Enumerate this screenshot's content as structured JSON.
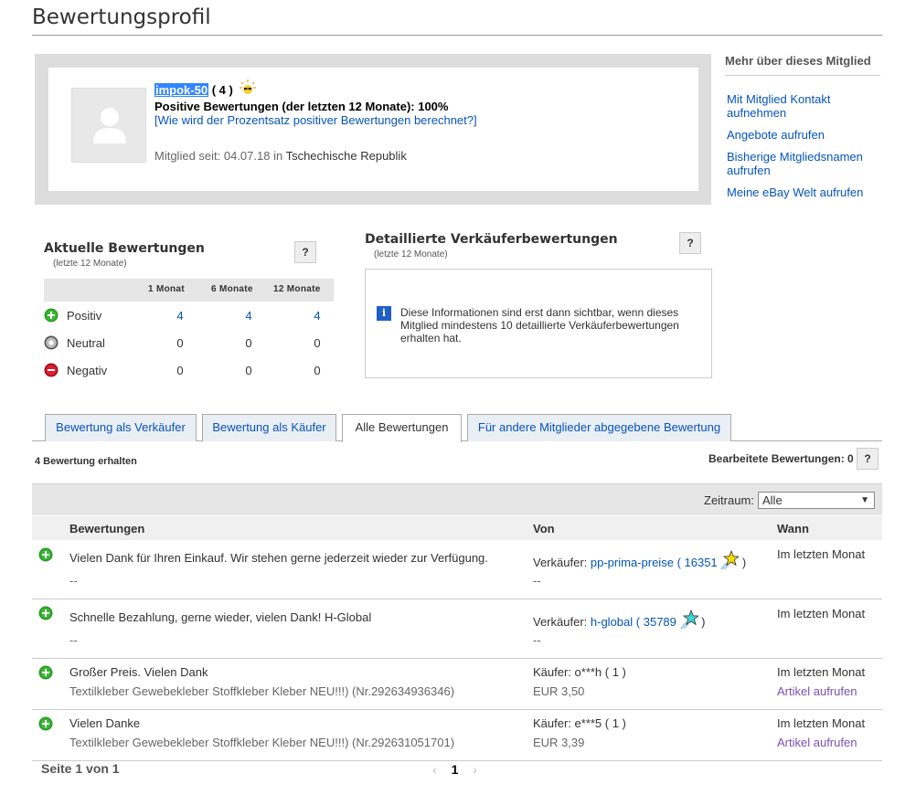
{
  "page_title": "Bewertungsprofil",
  "profile": {
    "username": "impok-50",
    "score": "( 4 )",
    "positive": "Positive Bewertungen (der letzten 12 Monate): 100%",
    "howcalc": "[Wie wird der Prozentsatz positiver Bewertungen berechnet?]",
    "member_label": "Mitglied seit: 04.07.18 in ",
    "member_country": "Tschechische Republik"
  },
  "side": {
    "title": "Mehr über dieses Mitglied",
    "links": [
      "Mit Mitglied Kontakt aufnehmen",
      "Angebote aufrufen",
      "Bisherige Mitgliedsnamen aufrufen",
      "Meine eBay Welt aufrufen"
    ]
  },
  "current": {
    "title": "Aktuelle Bewertungen",
    "sub": "(letzte 12 Monate)",
    "help": "?",
    "cols": [
      "1 Monat",
      "6 Monate",
      "12 Monate"
    ],
    "rows": [
      {
        "label": "Positiv",
        "values": [
          "4",
          "4",
          "4"
        ],
        "icon": "plus-circle-icon",
        "color": "#2a9b26"
      },
      {
        "label": "Neutral",
        "values": [
          "0",
          "0",
          "0"
        ],
        "icon": "neutral-circle-icon",
        "color": "#888888"
      },
      {
        "label": "Negativ",
        "values": [
          "0",
          "0",
          "0"
        ],
        "icon": "minus-circle-icon",
        "color": "#dd1e31"
      }
    ]
  },
  "dsr": {
    "title": "Detaillierte Verkäuferbewertungen",
    "sub": "(letzte 12 Monate)",
    "help": "?",
    "info": "Diese Informationen sind erst dann sichtbar, wenn dieses Mitglied mindestens 10 detaillierte Verkäuferbewertungen erhalten hat."
  },
  "tabs": [
    "Bewertung als Verkäufer",
    "Bewertung als Käufer",
    "Alle Bewertungen",
    "Für andere Mitglieder abgegebene Bewertung"
  ],
  "active_tab": "Alle Bewertungen",
  "received": "4 Bewertung erhalten",
  "processed": "Bearbeitete Bewertungen: 0",
  "filter": {
    "label": "Zeitraum:",
    "selected": "Alle"
  },
  "table": {
    "headers": [
      "Bewertungen",
      "Von",
      "Wann"
    ],
    "rows": [
      {
        "text": "Vielen Dank für Ihren Einkauf. Wir stehen gerne jederzeit wieder zur Verfügung.",
        "sub": "--",
        "from_prefix": "Verkäufer:",
        "from_user": "pp-prima-preise",
        "from_score": "16351",
        "star": "yellow-shooting-star-icon",
        "from_sub": "--",
        "when": "Im letzten Monat",
        "when_sub": ""
      },
      {
        "text": "Schnelle Bezahlung, gerne wieder, vielen Dank! H-Global",
        "sub": "--",
        "from_prefix": "Verkäufer:",
        "from_user": "h-global",
        "from_score": "35789",
        "star": "turquoise-shooting-star-icon",
        "from_sub": "--",
        "when": "Im letzten Monat",
        "when_sub": ""
      },
      {
        "text": "Großer Preis. Vielen Dank",
        "sub": "Textilkleber Gewebekleber Stoffkleber Kleber NEU!!!) (Nr.292634936346)",
        "from_text": "Käufer: o***h ( 1 )",
        "from_sub": "EUR 3,50",
        "when": "Im letzten Monat",
        "when_sub": "Artikel aufrufen"
      },
      {
        "text": "Vielen Danke",
        "sub": "Textilkleber Gewebekleber Stoffkleber Kleber NEU!!!) (Nr.292631051701)",
        "from_text": "Käufer: e***5 ( 1 )",
        "from_sub": "EUR 3,39",
        "when": "Im letzten Monat",
        "when_sub": "Artikel aufrufen"
      }
    ]
  },
  "pager": {
    "text": "Seite 1 von 1",
    "current": "1",
    "prev": "‹",
    "next": "›"
  }
}
